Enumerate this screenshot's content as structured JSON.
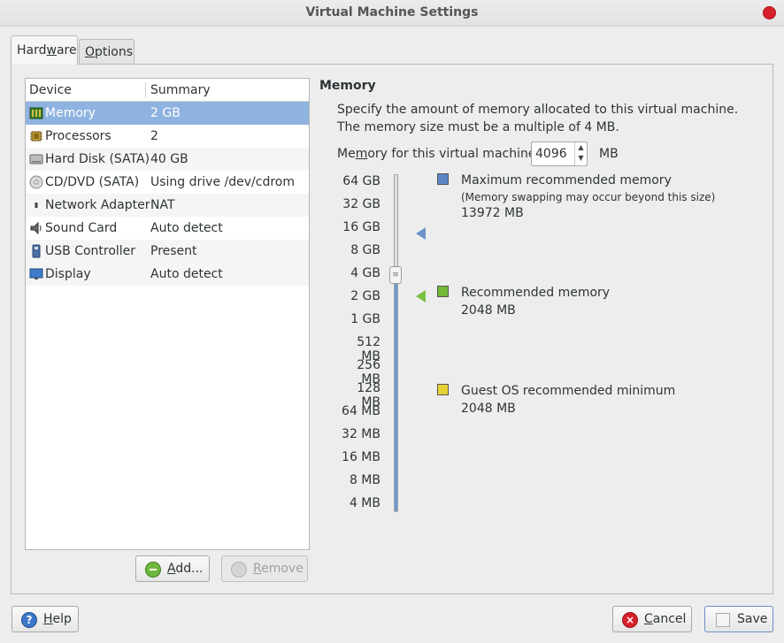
{
  "window": {
    "title": "Virtual Machine Settings"
  },
  "tabs": [
    {
      "label": "Hardware",
      "accel": "w",
      "pre": "Hard",
      "post": "are"
    },
    {
      "label": "Options",
      "accel": "O",
      "pre": "",
      "post": "ptions"
    }
  ],
  "device_list": {
    "headers": {
      "device": "Device",
      "summary": "Summary"
    },
    "rows": [
      {
        "device": "Memory",
        "summary": "2 GB",
        "icon": "memory-icon"
      },
      {
        "device": "Processors",
        "summary": "2",
        "icon": "processor-icon"
      },
      {
        "device": "Hard Disk (SATA)",
        "summary": "40 GB",
        "icon": "hard-disk-icon"
      },
      {
        "device": "CD/DVD (SATA)",
        "summary": "Using drive /dev/cdrom",
        "icon": "cd-dvd-icon"
      },
      {
        "device": "Network Adapter",
        "summary": "NAT",
        "icon": "network-icon"
      },
      {
        "device": "Sound Card",
        "summary": "Auto detect",
        "icon": "sound-card-icon"
      },
      {
        "device": "USB Controller",
        "summary": "Present",
        "icon": "usb-icon"
      },
      {
        "device": "Display",
        "summary": "Auto detect",
        "icon": "display-icon"
      }
    ],
    "selected": "Memory"
  },
  "buttons": {
    "add": {
      "pre": "",
      "accel": "A",
      "post": "dd..."
    },
    "remove": {
      "pre": "",
      "accel": "R",
      "post": "emove"
    },
    "help": {
      "pre": "",
      "accel": "H",
      "post": "elp"
    },
    "cancel": {
      "pre": "",
      "accel": "C",
      "post": "ancel"
    },
    "save": {
      "label": "Save"
    }
  },
  "memory": {
    "heading": "Memory",
    "description": "Specify the amount of memory allocated to this virtual machine. The memory size must be a multiple of 4 MB.",
    "label_pre": "Me",
    "label_accel": "m",
    "label_post": "ory for this virtual machine:",
    "value": "4096",
    "unit": "MB",
    "scale": [
      "64 GB",
      "32 GB",
      "16 GB",
      "8 GB",
      "4 GB",
      "2 GB",
      "1 GB",
      "512 MB",
      "256 MB",
      "128 MB",
      "64 MB",
      "32 MB",
      "16 MB",
      "8 MB",
      "4 MB"
    ],
    "legend": {
      "max": {
        "title": "Maximum recommended memory",
        "note": "(Memory swapping may occur beyond this size)",
        "value": "13972 MB",
        "color": "#5a86c4"
      },
      "recommended": {
        "title": "Recommended memory",
        "value": "2048 MB",
        "color": "#73b939"
      },
      "guest_min": {
        "title": "Guest OS recommended minimum",
        "value": "2048 MB",
        "color": "#e8d234"
      }
    }
  }
}
